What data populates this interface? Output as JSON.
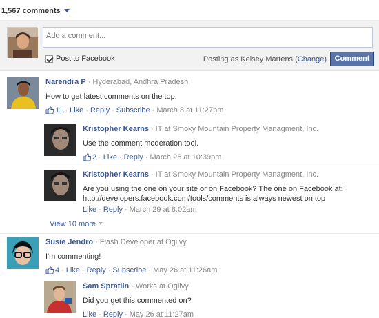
{
  "header": {
    "comment_count": "1,567 comments"
  },
  "composer": {
    "placeholder": "Add a comment...",
    "post_to_facebook_label": "Post to Facebook",
    "posting_as_prefix": "Posting as Kelsey Martens (",
    "change_label": "Change",
    "posting_as_suffix": ")",
    "comment_button": "Comment"
  },
  "comments": [
    {
      "author": "Narendra P",
      "meta": "Hyderabad, Andhra Pradesh",
      "text": "How to get latest comments on the top.",
      "likes": "11",
      "like": "Like",
      "reply": "Reply",
      "subscribe": "Subscribe",
      "time": "March 8 at 11:27pm"
    },
    {
      "author": "Kristopher Kearns",
      "meta": "IT at Smoky Mountain Property Managment, Inc.",
      "text": "Use the comment moderation tool.",
      "likes": "2",
      "like": "Like",
      "reply": "Reply",
      "time": "March 26 at 10:39pm"
    },
    {
      "author": "Kristopher Kearns",
      "meta": "IT at Smoky Mountain Property Managment, Inc.",
      "text_line1": "Are you using the one on your site or on Facebook? The one on Facebook at:",
      "text_line2": "http://developers.facebook.com/tools/comments is always newest on top",
      "like": "Like",
      "reply": "Reply",
      "time": "March 29 at 8:02am"
    },
    {
      "author": "Susie Jendro",
      "meta": "Flash Developer at Ogilvy",
      "text": "I'm commenting!",
      "likes": "4",
      "like": "Like",
      "reply": "Reply",
      "subscribe": "Subscribe",
      "time": "May 26 at 11:26am"
    },
    {
      "author": "Sam Spratlin",
      "meta": "Works at Ogilvy",
      "text": "Did you get this commented on?",
      "like": "Like",
      "reply": "Reply",
      "time": "May 26 at 11:27am"
    }
  ],
  "view_more": "View 10 more",
  "colors": {
    "link": "#3b5998",
    "button": "#5b74a8",
    "composer_bg": "#f2f2f2"
  }
}
